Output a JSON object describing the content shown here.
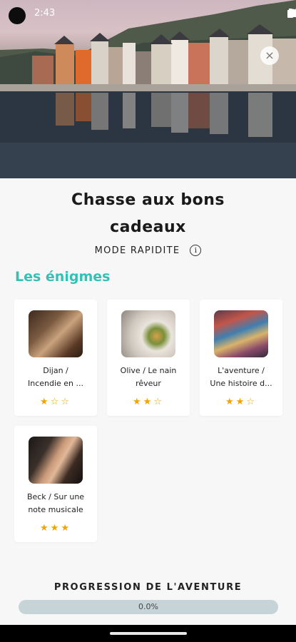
{
  "status": {
    "time": "2:43"
  },
  "header": {
    "close_icon": "close-icon"
  },
  "hunt": {
    "title_line1": "Chasse aux bons",
    "title_line2": "cadeaux",
    "mode": "MODE RAPIDITE",
    "info_icon": "info-icon"
  },
  "section": {
    "title": "Les énigmes"
  },
  "puzzles": [
    {
      "name_line1": "Dijan /",
      "name_line2": "Incendie en ...",
      "rating": 1,
      "stars_display": "★☆☆"
    },
    {
      "name_line1": "Olive / Le nain",
      "name_line2": "rêveur",
      "rating": 2,
      "stars_display": "★★☆"
    },
    {
      "name_line1": "L'aventure /",
      "name_line2": "Une histoire d...",
      "rating": 2,
      "stars_display": "★★☆"
    },
    {
      "name_line1": "Beck / Sur une",
      "name_line2": "note musicale",
      "rating": 3,
      "stars_display": "★★★"
    }
  ],
  "progress": {
    "title": "PROGRESSION DE L'AVENTURE",
    "value": 0.0,
    "label": "0.0%"
  },
  "colors": {
    "accent": "#35c0b4",
    "star": "#f4a300",
    "track": "#c7d4d7"
  }
}
